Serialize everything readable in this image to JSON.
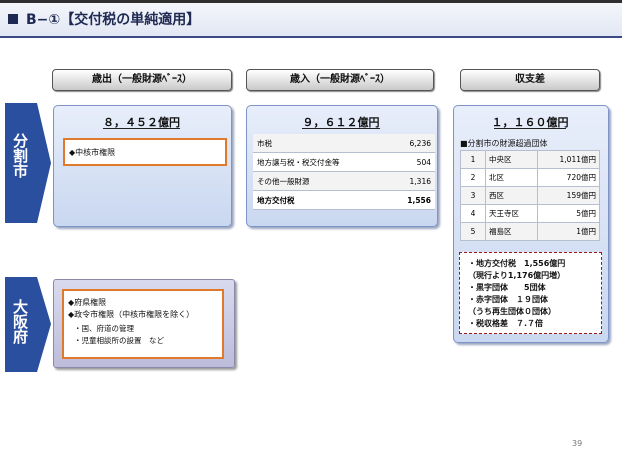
{
  "slide": {
    "title": "B−①【交付税の単純適用】",
    "page_number": "39",
    "colors": {
      "navy": "#1f2a52",
      "tab_blue": "#2a4f9e",
      "accent_orange": "#e07a2a",
      "dashed_red": "#a01818"
    }
  },
  "headers": {
    "expenditure": "歳出（一般財源ﾍﾞｰｽ）",
    "revenue": "歳入（一般財源ﾍﾞｰｽ）",
    "balance": "収支差"
  },
  "sides": {
    "split_city": "分割市",
    "osaka": "大阪府"
  },
  "expenditure": {
    "amount": "８，４５２億円",
    "item": "◆中核市権限"
  },
  "revenue": {
    "amount": "９，６１２億円",
    "rows": [
      {
        "label": "市税",
        "value": "6,236"
      },
      {
        "label": "地方譲与税・税交付金等",
        "value": "504"
      },
      {
        "label": "その他一般財源",
        "value": "1,316"
      },
      {
        "label": "地方交付税",
        "value": "1,556"
      }
    ]
  },
  "balance": {
    "amount": "１，１６０億円",
    "subtitle": "■分割市の財源超過団体",
    "wards": [
      {
        "no": "1",
        "name": "中央区",
        "value": "1,011億円"
      },
      {
        "no": "2",
        "name": "北区",
        "value": "720億円"
      },
      {
        "no": "3",
        "name": "西区",
        "value": "159億円"
      },
      {
        "no": "4",
        "name": "天王寺区",
        "value": "5億円"
      },
      {
        "no": "5",
        "name": "福島区",
        "value": "1億円"
      }
    ],
    "summary": [
      "・地方交付税　1,556億円",
      "（現行より1,176億円増）",
      "・黒字団体　　5団体",
      "・赤字団体　１９団体",
      "（うち再生団体０団体）",
      "・税収格差　７.７倍"
    ]
  },
  "osaka": {
    "items": [
      "◆府県権限",
      "◆政令市権限（中核市権限を除く）",
      "・国、府道の管理",
      "・児童相談所の設置　など"
    ]
  }
}
